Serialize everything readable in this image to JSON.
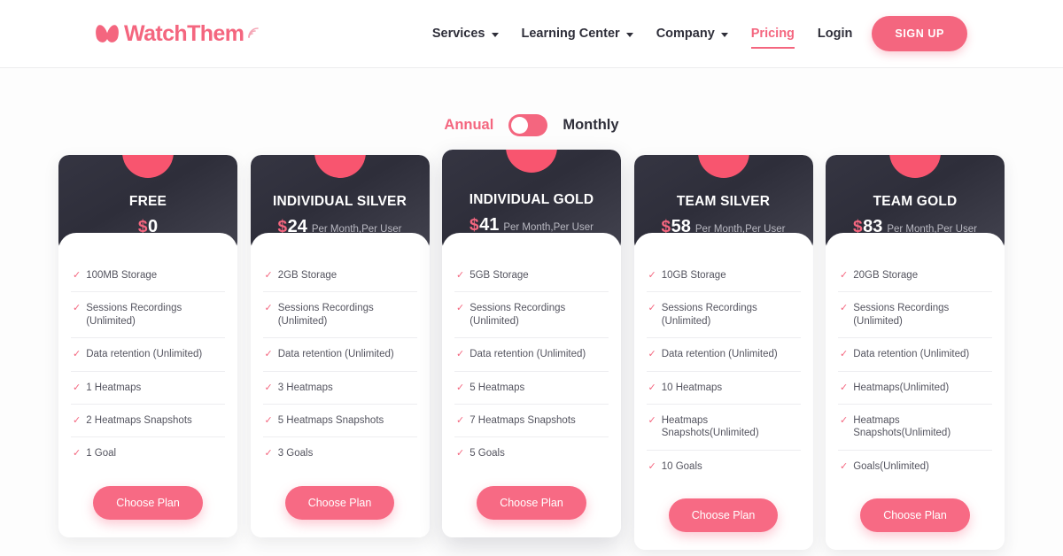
{
  "header": {
    "logo": {
      "text": "WatchThem",
      "icon": "watchthem-logo-icon"
    },
    "nav": [
      {
        "label": "Services",
        "has_caret": true,
        "active": false
      },
      {
        "label": "Learning Center",
        "has_caret": true,
        "active": false
      },
      {
        "label": "Company",
        "has_caret": true,
        "active": false
      },
      {
        "label": "Pricing",
        "has_caret": false,
        "active": true
      },
      {
        "label": "Login",
        "has_caret": false,
        "active": false
      }
    ],
    "signup_label": "SIGN UP"
  },
  "billing": {
    "annual_label": "Annual",
    "monthly_label": "Monthly",
    "selected": "Annual"
  },
  "colors": {
    "accent_pink": "#f4667f",
    "button_pink": "#f76a84",
    "card_dark": "#2e2e3a",
    "blob_pink": "#f8556f",
    "text_dark": "#2f2f3a",
    "feature_text": "#54545f",
    "period_text": "#b9b9c2"
  },
  "plans": [
    {
      "name": "FREE",
      "currency": "$",
      "amount": "0",
      "period": "",
      "featured": false,
      "features": [
        "100MB Storage",
        "Sessions Recordings (Unlimited)",
        "Data retention (Unlimited)",
        "1 Heatmaps",
        "2 Heatmaps Snapshots",
        "1 Goal"
      ],
      "cta": "Choose Plan"
    },
    {
      "name": "INDIVIDUAL SILVER",
      "currency": "$",
      "amount": "24",
      "period": "Per Month,Per User",
      "featured": false,
      "features": [
        "2GB Storage",
        "Sessions Recordings (Unlimited)",
        "Data retention (Unlimited)",
        "3 Heatmaps",
        "5 Heatmaps Snapshots",
        "3 Goals"
      ],
      "cta": "Choose Plan"
    },
    {
      "name": "INDIVIDUAL GOLD",
      "currency": "$",
      "amount": "41",
      "period": "Per Month,Per User",
      "featured": true,
      "features": [
        "5GB Storage",
        "Sessions Recordings (Unlimited)",
        "Data retention (Unlimited)",
        "5 Heatmaps",
        "7 Heatmaps Snapshots",
        "5 Goals"
      ],
      "cta": "Choose Plan"
    },
    {
      "name": "TEAM SILVER",
      "currency": "$",
      "amount": "58",
      "period": "Per Month,Per User",
      "featured": false,
      "features": [
        "10GB Storage",
        "Sessions Recordings (Unlimited)",
        "Data retention (Unlimited)",
        "10 Heatmaps",
        "Heatmaps Snapshots(Unlimited)",
        "10 Goals"
      ],
      "cta": "Choose Plan"
    },
    {
      "name": "TEAM GOLD",
      "currency": "$",
      "amount": "83",
      "period": "Per Month,Per User",
      "featured": false,
      "features": [
        "20GB Storage",
        "Sessions Recordings (Unlimited)",
        "Data retention (Unlimited)",
        "Heatmaps(Unlimited)",
        "Heatmaps Snapshots(Unlimited)",
        "Goals(Unlimited)"
      ],
      "cta": "Choose Plan"
    }
  ]
}
